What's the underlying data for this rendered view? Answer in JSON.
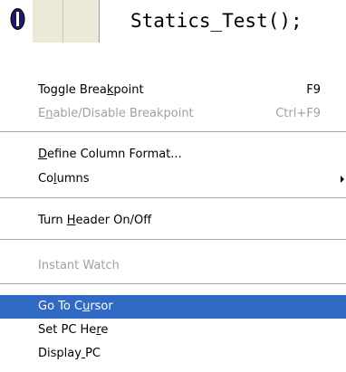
{
  "code_line": {
    "icon": "breakpoint-icon",
    "text": "Statics_Test();"
  },
  "colors": {
    "menu_highlight": "#316ac5",
    "disabled_text": "#a0a0a0",
    "breakpoint_fill": "#1b1b6b"
  },
  "menu": {
    "items": [
      {
        "pre": "Toggle Brea",
        "u": "k",
        "post": "point",
        "accel": "F9",
        "disabled": false,
        "highlighted": false
      },
      {
        "pre": "E",
        "u": "n",
        "post": "able/Disable Breakpoint",
        "accel": "Ctrl+F9",
        "disabled": true,
        "highlighted": false
      },
      {
        "pre": "",
        "u": "D",
        "post": "efine Column Format...",
        "accel": "",
        "disabled": false,
        "highlighted": false
      },
      {
        "pre": "Co",
        "u": "l",
        "post": "umns",
        "accel": "",
        "submenu": true,
        "disabled": false,
        "highlighted": false
      },
      {
        "pre": "Turn ",
        "u": "H",
        "post": "eader On/Off",
        "accel": "",
        "disabled": false,
        "highlighted": false
      },
      {
        "pre": "Instant Watch",
        "u": "",
        "post": "",
        "accel": "",
        "disabled": true,
        "highlighted": false
      },
      {
        "pre": "Go To C",
        "u": "u",
        "post": "rsor",
        "accel": "",
        "disabled": false,
        "highlighted": true
      },
      {
        "pre": "Set PC He",
        "u": "r",
        "post": "e",
        "accel": "",
        "disabled": false,
        "highlighted": false
      },
      {
        "pre": "Display",
        "u": " ",
        "post": "PC",
        "accel": "",
        "disabled": false,
        "highlighted": false
      }
    ]
  }
}
